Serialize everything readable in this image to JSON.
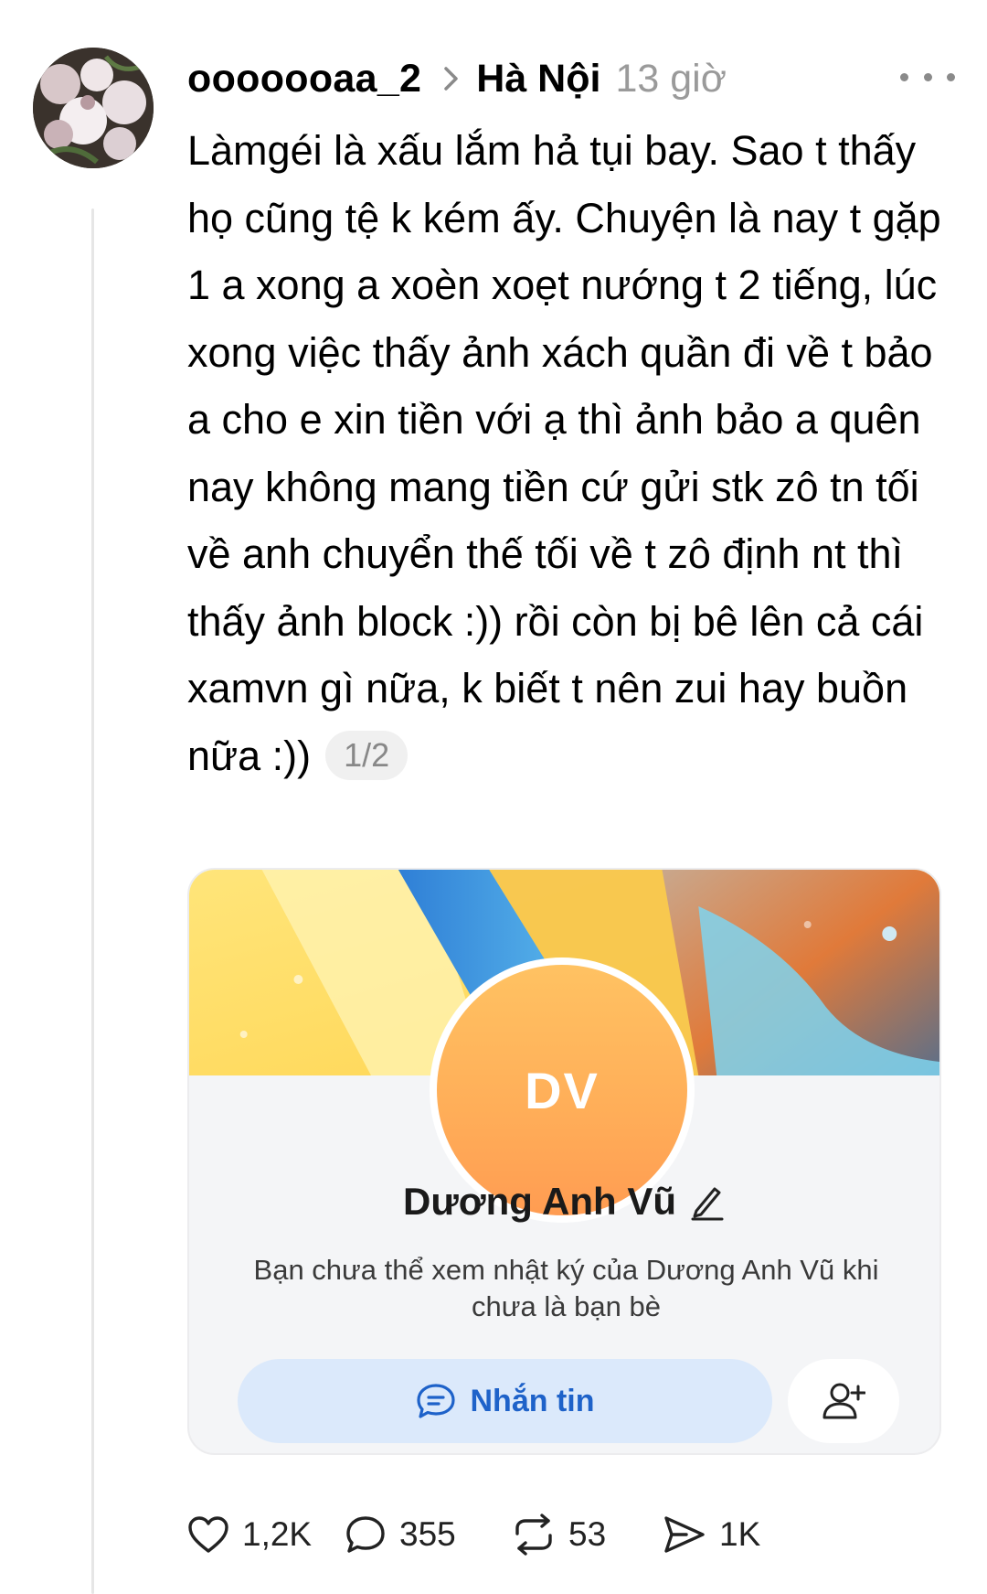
{
  "post": {
    "username": "ooooooaa_2",
    "location": "Hà Nội",
    "time": "13 giờ",
    "text": "Làmgéi là xấu lắm hả tụi bay. Sao t thấy họ cũng tệ k kém ấy. Chuyện là nay t gặp 1 a xong a xoèn xoẹt nướng t 2 tiếng, lúc xong việc thấy ảnh xách quần đi về t bảo a cho e xin tiền với ạ thì ảnh bảo a quên nay không mang tiền cứ gửi stk zô tn tối về anh chuyển thế tối về t zô định nt thì thấy ảnh block :)) rồi còn bị bê lên cả cái xamvn gì nữa, k biết t nên zui hay buồn nữa :))",
    "page_indicator": "1/2"
  },
  "card": {
    "initials": "DV",
    "name": "Dương Anh Vũ",
    "notice": "Bạn chưa thể xem nhật ký của Dương Anh Vũ khi chưa là bạn bè",
    "message_button": "Nhắn tin",
    "accent": "#1e62c9",
    "avatar_color": "#ffad58"
  },
  "actions": {
    "likes": "1,2K",
    "comments": "355",
    "reposts": "53",
    "shares": "1K"
  },
  "icons": [
    "chevron-right-icon",
    "more-icon",
    "edit-icon",
    "chat-bubble-icon",
    "add-friend-icon",
    "heart-icon",
    "comment-icon",
    "repost-icon",
    "share-icon"
  ]
}
